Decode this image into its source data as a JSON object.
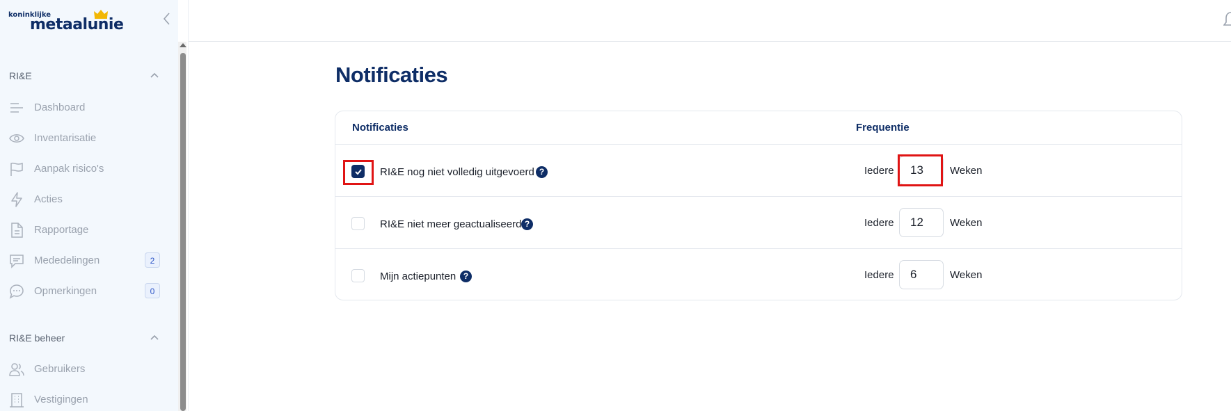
{
  "logo": {
    "small": "koninklijke",
    "big": "metaalunie"
  },
  "sidebar": {
    "sections": [
      {
        "title": "RI&E",
        "items": [
          {
            "label": "Dashboard",
            "icon": "menu-lines-icon"
          },
          {
            "label": "Inventarisatie",
            "icon": "eye-icon"
          },
          {
            "label": "Aanpak risico's",
            "icon": "flag-icon"
          },
          {
            "label": "Acties",
            "icon": "lightning-icon"
          },
          {
            "label": "Rapportage",
            "icon": "document-icon"
          },
          {
            "label": "Mededelingen",
            "icon": "message-icon",
            "badge": "2"
          },
          {
            "label": "Opmerkingen",
            "icon": "chat-bubble-icon",
            "badge": "0"
          }
        ]
      },
      {
        "title": "RI&E beheer",
        "items": [
          {
            "label": "Gebruikers",
            "icon": "users-icon"
          },
          {
            "label": "Vestigingen",
            "icon": "building-icon"
          }
        ]
      }
    ]
  },
  "main": {
    "title": "Notificaties",
    "table": {
      "headers": {
        "notifications": "Notificaties",
        "frequency": "Frequentie"
      },
      "rows": [
        {
          "label": "RI&E nog niet volledig uitgevoerd",
          "checked": true,
          "every": "Iedere",
          "value": "13",
          "unit": "Weken"
        },
        {
          "label": "RI&E niet meer geactualiseerd",
          "checked": false,
          "every": "Iedere",
          "value": "12",
          "unit": "Weken"
        },
        {
          "label": "Mijn actiepunten",
          "checked": false,
          "every": "Iedere",
          "value": "6",
          "unit": "Weken"
        }
      ]
    },
    "help_glyph": "?"
  },
  "colors": {
    "primary": "#0e2d66",
    "sidebar_bg": "#f3f8fd",
    "highlight": "#e01414",
    "badge_text": "#2f57c7"
  }
}
